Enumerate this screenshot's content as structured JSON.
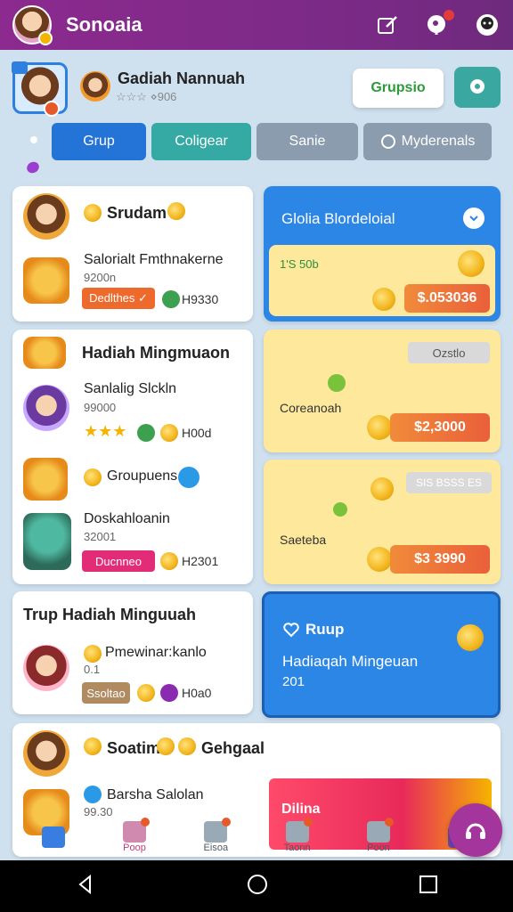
{
  "app": {
    "title": "Sonoaia"
  },
  "profile": {
    "name": "Gadiah Nannuah",
    "sub": "☆☆☆ ⋄906",
    "grupsio_label": "Grupsio"
  },
  "tabs": [
    {
      "label": "Grup"
    },
    {
      "label": "Coligear"
    },
    {
      "label": "Sanie"
    },
    {
      "label": "Myderenals"
    }
  ],
  "left_card1": {
    "title": "Srudam",
    "item_title": "Salorialt Fmthnakerne",
    "item_sub": "9200n",
    "pill_label": "Dedlthes ✓",
    "amount": "H9330"
  },
  "right_card1": {
    "title": "Glolia Blordeloial",
    "tag": "1'S 50b",
    "price": "$.053036"
  },
  "left_card2": {
    "title": "Hadiah Mingmuaon",
    "item1_title": "Sanlalig Slckln",
    "item1_sub": "99000",
    "item1_amount": "H00d",
    "item2_title": "Groupuens",
    "item3_title": "Doskahloanin",
    "item3_sub": "32001",
    "item3_pill": "Ducnneo",
    "item3_amount": "H2301"
  },
  "right_card2": {
    "label": "Coreanoah",
    "tag": "Ozstlo",
    "price": "$2,3000"
  },
  "right_card3": {
    "label": "Saeteba",
    "tag": "SIS BSSS ES",
    "price": "$3 3990"
  },
  "left_card3": {
    "title": "Trup Hadiah Minguuah",
    "item_title": "Pmewinar:kanlo",
    "item_sub": "0.1",
    "pill_label": "Ssoltao",
    "amount": "H0a0"
  },
  "right_card4": {
    "title": "Ruup",
    "line1": "Hadiaqah Mingeuan",
    "line2": "201"
  },
  "bottom_card": {
    "title1": "Soatim",
    "title2": "Gehgaal",
    "item_title": "Barsha Salolan",
    "item_sub": "99.30",
    "banner": "Dilina"
  },
  "nav": [
    {
      "label": "Poop"
    },
    {
      "label": "Eisoa"
    },
    {
      "label": "Taonn"
    },
    {
      "label": "Poon"
    }
  ],
  "colors": {
    "app_bar": "#8c2a8f",
    "accent_blue": "#2474d8",
    "accent_teal": "#35a9a3",
    "promo_yellow": "#fde89b",
    "price_orange": "#ea5f3a"
  }
}
